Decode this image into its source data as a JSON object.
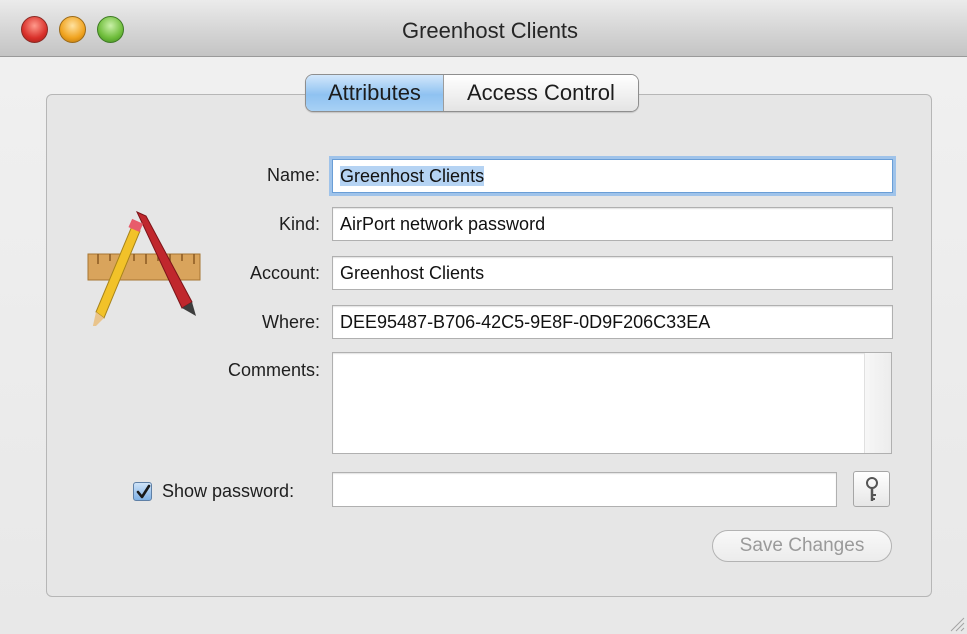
{
  "window": {
    "title": "Greenhost Clients"
  },
  "tabs": [
    {
      "label": "Attributes",
      "selected": true
    },
    {
      "label": "Access Control",
      "selected": false
    }
  ],
  "icon": {
    "name": "keychain-item-app-icon"
  },
  "fields": {
    "name": {
      "label": "Name:",
      "value": "Greenhost Clients"
    },
    "kind": {
      "label": "Kind:",
      "value": "AirPort network password"
    },
    "account": {
      "label": "Account:",
      "value": "Greenhost Clients"
    },
    "where": {
      "label": "Where:",
      "value": "DEE95487-B706-42C5-9E8F-0D9F206C33EA"
    },
    "comments": {
      "label": "Comments:",
      "value": ""
    }
  },
  "show_password": {
    "label": "Show password:",
    "checked": true,
    "value": ""
  },
  "buttons": {
    "save_label": "Save Changes",
    "save_enabled": false
  },
  "colors": {
    "tab_selected": "#8fc2f1",
    "focus_ring": "#9fc3ea",
    "checkbox": "#7fb1e6"
  }
}
